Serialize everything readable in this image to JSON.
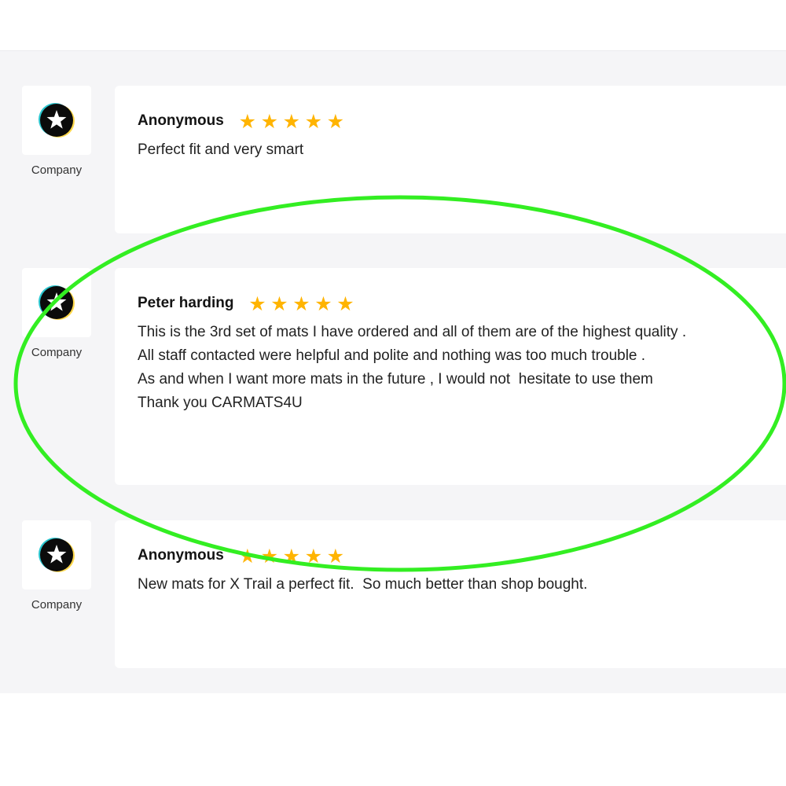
{
  "reviews": [
    {
      "avatar_caption": "Company",
      "name": "Anonymous",
      "rating": 5,
      "text": "Perfect fit and very smart"
    },
    {
      "avatar_caption": "Company",
      "name": "Peter harding",
      "rating": 5,
      "text": "This is the 3rd set of mats I have ordered and all of them are of the highest quality .\nAll staff contacted were helpful and polite and nothing was too much trouble .\nAs and when I want more mats in the future , I would not  hesitate to use them\nThank you CARMATS4U"
    },
    {
      "avatar_caption": "Company",
      "name": "Anonymous",
      "rating": 5,
      "text": "New mats for X Trail a perfect fit.  So much better than shop bought."
    }
  ],
  "colors": {
    "star": "#ffb400",
    "highlight_ellipse": "#33ee22",
    "panel_background": "#f5f5f7"
  },
  "icons": {
    "avatar": "star-in-circle-icon",
    "rating": "star-icon"
  }
}
